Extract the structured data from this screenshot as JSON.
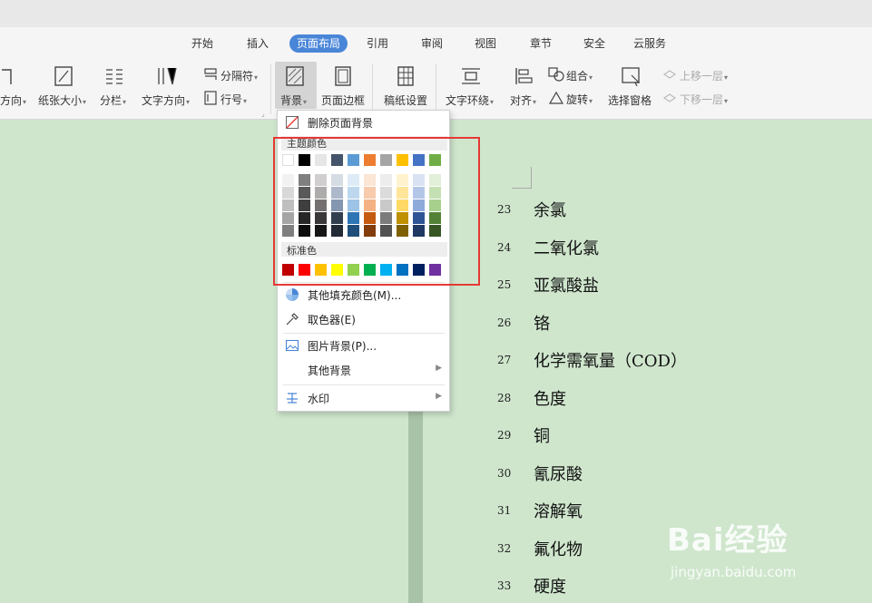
{
  "tabs": [
    {
      "label": "开始"
    },
    {
      "label": "插入"
    },
    {
      "label": "页面布局",
      "active": true
    },
    {
      "label": "引用"
    },
    {
      "label": "审阅"
    },
    {
      "label": "视图"
    },
    {
      "label": "章节"
    },
    {
      "label": "安全"
    },
    {
      "label": "云服务"
    }
  ],
  "ribbon": {
    "orientation": "方向",
    "paper_size": "纸张大小",
    "columns": "分栏",
    "text_direction": "文字方向",
    "separator": "分隔符",
    "line_number": "行号",
    "background": "背景",
    "page_border": "页面边框",
    "draft_paper": "稿纸设置",
    "text_wrap": "文字环绕",
    "align": "对齐",
    "group": "组合",
    "rotate": "旋转",
    "selection_pane": "选择窗格",
    "bring_forward": "上移一层",
    "send_backward": "下移一层"
  },
  "menu": {
    "remove_bg": "删除页面背景",
    "theme_colors": "主题颜色",
    "standard_colors": "标准色",
    "more_fill": "其他填充颜色(M)...",
    "picker": "取色器(E)",
    "picture_bg": "图片背景(P)...",
    "other_bg": "其他背景",
    "watermark": "水印"
  },
  "theme_top_row": [
    "#ffffff",
    "#000000",
    "#e7e6e6",
    "#44546a",
    "#5b9bd5",
    "#ed7d31",
    "#a5a5a5",
    "#ffc000",
    "#4472c4",
    "#70ad47"
  ],
  "theme_shades": [
    [
      "#f2f2f2",
      "#7f7f7f",
      "#d0cece",
      "#d6dce4",
      "#deebf6",
      "#fbe5d5",
      "#ededed",
      "#fff2cc",
      "#d9e2f3",
      "#e2efd9"
    ],
    [
      "#d8d8d8",
      "#595959",
      "#aeabab",
      "#adb9ca",
      "#bdd7ee",
      "#f7cbac",
      "#dbdbdb",
      "#fee599",
      "#b4c6e7",
      "#c5e0b3"
    ],
    [
      "#bfbfbf",
      "#3f3f3f",
      "#757070",
      "#8496b0",
      "#9dc3e6",
      "#f4b183",
      "#c9c9c9",
      "#ffd965",
      "#8eaadb",
      "#a8d08d"
    ],
    [
      "#a5a5a5",
      "#262626",
      "#3a3838",
      "#323f4f",
      "#2e75b5",
      "#c55a11",
      "#7b7b7b",
      "#bf9000",
      "#2f5496",
      "#538135"
    ],
    [
      "#7f7f7f",
      "#0c0c0c",
      "#171616",
      "#222a35",
      "#1e4e79",
      "#833c0b",
      "#525252",
      "#7f6000",
      "#1f3864",
      "#375623"
    ]
  ],
  "standard_colors_list": [
    "#c00000",
    "#ff0000",
    "#ffc000",
    "#ffff00",
    "#92d050",
    "#00b050",
    "#00b0f0",
    "#0070c0",
    "#002060",
    "#7030a0"
  ],
  "document_rows": [
    {
      "num": "23",
      "text": "余氯"
    },
    {
      "num": "24",
      "text": "二氧化氯"
    },
    {
      "num": "25",
      "text": "亚氯酸盐"
    },
    {
      "num": "26",
      "text": "铬"
    },
    {
      "num": "27",
      "text": "化学需氧量（COD）"
    },
    {
      "num": "28",
      "text": "色度"
    },
    {
      "num": "29",
      "text": "铜"
    },
    {
      "num": "30",
      "text": "氰尿酸"
    },
    {
      "num": "31",
      "text": "溶解氧"
    },
    {
      "num": "32",
      "text": "氟化物"
    },
    {
      "num": "33",
      "text": "硬度"
    }
  ],
  "watermark_logo": "Bai经验",
  "watermark_url": "jingyan.baidu.com"
}
